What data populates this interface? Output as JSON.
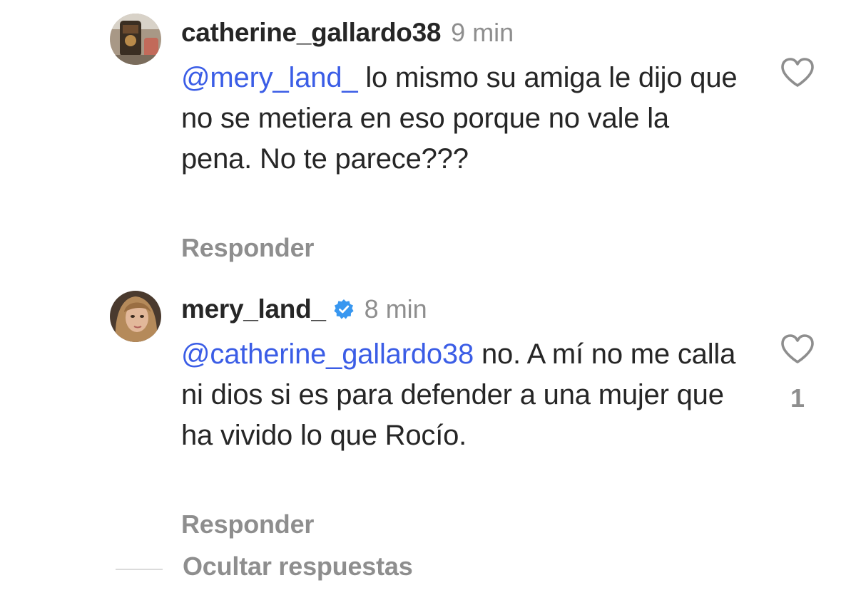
{
  "comments": [
    {
      "username": "catherine_gallardo38",
      "time": "9 min",
      "verified": false,
      "mention": "@mery_land_",
      "text": " lo mismo su amiga le dijo que no se metiera en eso porque no vale la pena. No te parece???",
      "reply_label": "Responder",
      "like_icon": "heart-outline-icon",
      "like_count": ""
    },
    {
      "username": "mery_land_",
      "time": "8 min",
      "verified": true,
      "verified_icon": "verified-badge-icon",
      "mention": "@catherine_gallardo38",
      "text": " no. A mí no me calla ni dios si es para defender a una mujer que ha vivido lo que Rocío.",
      "reply_label": "Responder",
      "like_icon": "heart-outline-icon",
      "like_count": "1"
    }
  ],
  "hide_replies_label": "Ocultar respuestas",
  "colors": {
    "mention": "#3b5de6",
    "muted": "#8e8e8e",
    "text": "#262626",
    "verified": "#3897f0"
  }
}
